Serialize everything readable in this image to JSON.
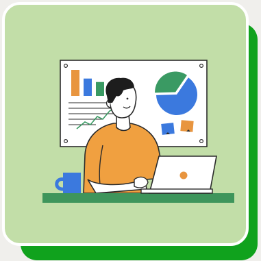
{
  "colors": {
    "background": "#f0efec",
    "shadow_card": "#10a21d",
    "card": "#c2dea8",
    "card_border": "#ffffff",
    "board": "#ffffff",
    "board_outline": "#2b2b2b",
    "bar_orange": "#e8953f",
    "bar_blue": "#3b79de",
    "bar_green": "#3a9a63",
    "pie_blue": "#3b79de",
    "pie_green": "#3a9a63",
    "trend_line": "#3a9a63",
    "shirt": "#f0a040",
    "skin": "#ffffff",
    "hair": "#1d1d1d",
    "desk": "#3e955b",
    "laptop": "#ffffff",
    "laptop_dot": "#e8953f",
    "mug": "#3b79de"
  },
  "illustration": {
    "subject": "person-working-at-laptop",
    "board_content": [
      "bar-chart",
      "pie-chart",
      "line-chart",
      "sticky-notes"
    ]
  },
  "chart_data": [
    {
      "type": "bar",
      "categories": [
        "",
        "",
        ""
      ],
      "values": [
        3,
        2,
        1.6
      ],
      "colors": [
        "#e8953f",
        "#3b79de",
        "#3a9a63"
      ]
    },
    {
      "type": "pie",
      "values": [
        65,
        35
      ],
      "colors": [
        "#3b79de",
        "#3a9a63"
      ]
    }
  ]
}
